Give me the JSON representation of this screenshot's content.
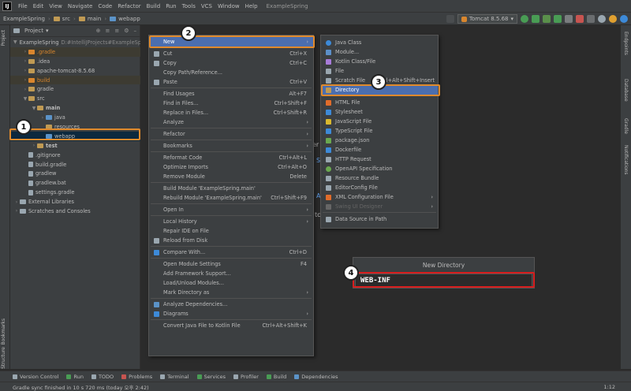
{
  "menubar": {
    "logo": "IJ",
    "items": [
      "File",
      "Edit",
      "View",
      "Navigate",
      "Code",
      "Refactor",
      "Build",
      "Run",
      "Tools",
      "VCS",
      "Window",
      "Help"
    ],
    "window_title": "ExampleSpring"
  },
  "navbar": {
    "breadcrumbs": [
      "ExampleSpring",
      "src",
      "main",
      "webapp"
    ],
    "run_config": "Tomcat 8.5.68"
  },
  "left_strip": {
    "top": "Project",
    "bottom1": "Bookmarks",
    "bottom2": "Structure"
  },
  "right_strip": [
    "Endpoints",
    "Database",
    "Gradle",
    "Notifications"
  ],
  "project_panel": {
    "header": "Project",
    "tree": [
      {
        "label": "ExampleSpring",
        "path": "D:#IntelliJProjects#ExampleSpring",
        "indent": 0,
        "arrow": "▼",
        "kind": "module"
      },
      {
        "label": ".gradle",
        "indent": 1,
        "arrow": "›",
        "kind": "excluded"
      },
      {
        "label": ".idea",
        "indent": 1,
        "arrow": "›",
        "kind": "folder"
      },
      {
        "label": "apache-tomcat-8.5.68",
        "indent": 1,
        "arrow": "›",
        "kind": "folder"
      },
      {
        "label": "build",
        "indent": 1,
        "arrow": "›",
        "kind": "excluded"
      },
      {
        "label": "gradle",
        "indent": 1,
        "arrow": "›",
        "kind": "folder"
      },
      {
        "label": "src",
        "indent": 1,
        "arrow": "▼",
        "kind": "folder"
      },
      {
        "label": "main",
        "indent": 2,
        "arrow": "▼",
        "kind": "folder",
        "bold": true
      },
      {
        "label": "java",
        "indent": 3,
        "arrow": "›",
        "kind": "source"
      },
      {
        "label": "resources",
        "indent": 3,
        "arrow": "",
        "kind": "folder"
      },
      {
        "label": "webapp",
        "indent": 3,
        "arrow": "",
        "kind": "web",
        "selected": true
      },
      {
        "label": "test",
        "indent": 2,
        "arrow": "›",
        "kind": "folder",
        "bold": true
      },
      {
        "label": ".gitignore",
        "indent": 1,
        "arrow": "",
        "kind": "file"
      },
      {
        "label": "build.gradle",
        "indent": 1,
        "arrow": "",
        "kind": "file"
      },
      {
        "label": "gradlew",
        "indent": 1,
        "arrow": "",
        "kind": "file"
      },
      {
        "label": "gradlew.bat",
        "indent": 1,
        "arrow": "",
        "kind": "file"
      },
      {
        "label": "settings.gradle",
        "indent": 1,
        "arrow": "",
        "kind": "file"
      },
      {
        "label": "External Libraries",
        "indent": 0,
        "arrow": "›",
        "kind": "lib"
      },
      {
        "label": "Scratches and Consoles",
        "indent": 0,
        "arrow": "›",
        "kind": "scratch"
      }
    ]
  },
  "context_menu": {
    "items": [
      {
        "label": "New",
        "sub": true,
        "highlight": true
      },
      {
        "sep": true
      },
      {
        "label": "Cut",
        "shortcut": "Ctrl+X",
        "icon": "cut"
      },
      {
        "label": "Copy",
        "shortcut": "Ctrl+C",
        "icon": "copy"
      },
      {
        "label": "Copy Path/Reference...",
        "shortcut": ""
      },
      {
        "label": "Paste",
        "shortcut": "Ctrl+V",
        "icon": "paste"
      },
      {
        "sep": true
      },
      {
        "label": "Find Usages",
        "shortcut": "Alt+F7"
      },
      {
        "label": "Find in Files...",
        "shortcut": "Ctrl+Shift+F"
      },
      {
        "label": "Replace in Files...",
        "shortcut": "Ctrl+Shift+R"
      },
      {
        "label": "Analyze",
        "sub": true
      },
      {
        "sep": true
      },
      {
        "label": "Refactor",
        "sub": true
      },
      {
        "sep": true
      },
      {
        "label": "Bookmarks",
        "sub": true
      },
      {
        "sep": true
      },
      {
        "label": "Reformat Code",
        "shortcut": "Ctrl+Alt+L"
      },
      {
        "label": "Optimize Imports",
        "shortcut": "Ctrl+Alt+O"
      },
      {
        "label": "Remove Module",
        "shortcut": "Delete"
      },
      {
        "sep": true
      },
      {
        "label": "Build Module 'ExampleSpring.main'",
        "shortcut": ""
      },
      {
        "label": "Rebuild Module 'ExampleSpring.main'",
        "shortcut": "Ctrl+Shift+F9"
      },
      {
        "sep": true
      },
      {
        "label": "Open In",
        "sub": true
      },
      {
        "sep": true
      },
      {
        "label": "Local History",
        "sub": true
      },
      {
        "label": "Repair IDE on File",
        "shortcut": ""
      },
      {
        "label": "Reload from Disk",
        "shortcut": "",
        "icon": "reload"
      },
      {
        "sep": true
      },
      {
        "label": "Compare With...",
        "shortcut": "Ctrl+D",
        "icon": "compare"
      },
      {
        "sep": true
      },
      {
        "label": "Open Module Settings",
        "shortcut": "F4"
      },
      {
        "label": "Add Framework Support...",
        "shortcut": ""
      },
      {
        "label": "Load/Unload Modules...",
        "shortcut": ""
      },
      {
        "label": "Mark Directory as",
        "sub": true
      },
      {
        "sep": true
      },
      {
        "label": "Analyze Dependencies...",
        "shortcut": "",
        "icon": "analyze"
      },
      {
        "label": "Diagrams",
        "sub": true,
        "icon": "diagram"
      },
      {
        "sep": true
      },
      {
        "label": "Convert Java File to Kotlin File",
        "shortcut": "Ctrl+Alt+Shift+K"
      }
    ]
  },
  "submenu": {
    "items": [
      {
        "label": "Java Class",
        "color": "#3d8ad8",
        "round": true
      },
      {
        "label": "Module...",
        "color": "#5c90c9"
      },
      {
        "label": "Kotlin Class/File",
        "color": "#a87bd9"
      },
      {
        "label": "File",
        "color": "#9aa7b0"
      },
      {
        "label": "Scratch File",
        "shortcut": "Ctrl+Alt+Shift+Insert",
        "color": "#9aa7b0"
      },
      {
        "label": "Directory",
        "color": "#c09a53",
        "highlight": true
      },
      {
        "sep": true
      },
      {
        "label": "HTML File",
        "color": "#e06c2b"
      },
      {
        "label": "Stylesheet",
        "color": "#3d8ad8"
      },
      {
        "label": "JavaScript File",
        "color": "#d9b82e"
      },
      {
        "label": "TypeScript File",
        "color": "#3d8ad8"
      },
      {
        "label": "package.json",
        "color": "#6aa84f"
      },
      {
        "label": "Dockerfile",
        "color": "#3d8ad8"
      },
      {
        "label": "HTTP Request",
        "color": "#9aa7b0"
      },
      {
        "label": "OpenAPI Specification",
        "color": "#6aa84f",
        "round": true
      },
      {
        "label": "Resource Bundle",
        "color": "#9aa7b0"
      },
      {
        "label": "EditorConfig File",
        "color": "#9aa7b0"
      },
      {
        "label": "XML Configuration File",
        "color": "#e06c2b",
        "sub": true
      },
      {
        "label": "Swing UI Designer",
        "disabled": true,
        "color": "#666",
        "sub": true
      },
      {
        "sep": true
      },
      {
        "label": "Data Source in Path",
        "color": "#9aa7b0"
      }
    ]
  },
  "dialog": {
    "title": "New Directory",
    "value": "WEB-INF"
  },
  "badges": [
    "1",
    "2",
    "3",
    "4"
  ],
  "editor_fragments": [
    "er",
    "S",
    "A",
    "tc"
  ],
  "bottom_tools": [
    "Version Control",
    "Run",
    "TODO",
    "Problems",
    "Terminal",
    "Services",
    "Profiler",
    "Build",
    "Dependencies"
  ],
  "status": {
    "message": "Gradle sync finished in 10 s 720 ms (today 오후 2:42)",
    "position": "1:12"
  },
  "colors": {
    "accent": "#4b6eaf",
    "highlight_box": "#e08a2c",
    "dialog_box": "#d81e1e"
  }
}
